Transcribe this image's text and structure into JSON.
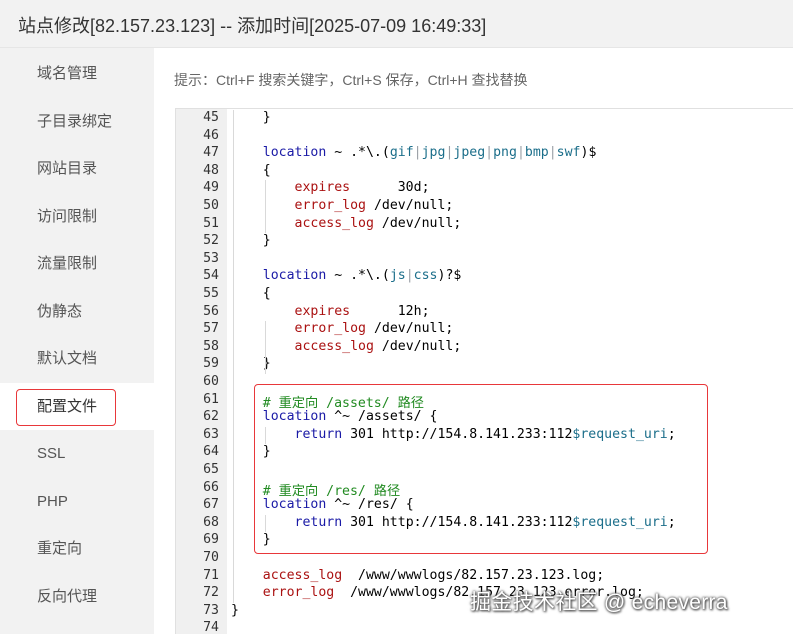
{
  "title": "站点修改[82.157.23.123] -- 添加时间[2025-07-09 16:49:33]",
  "hint": "提示：Ctrl+F 搜索关键字，Ctrl+S 保存，Ctrl+H 查找替换",
  "sidebar": {
    "items": [
      {
        "label": "域名管理",
        "active": false
      },
      {
        "label": "子目录绑定",
        "active": false
      },
      {
        "label": "网站目录",
        "active": false
      },
      {
        "label": "访问限制",
        "active": false
      },
      {
        "label": "流量限制",
        "active": false
      },
      {
        "label": "伪静态",
        "active": false
      },
      {
        "label": "默认文档",
        "active": false
      },
      {
        "label": "配置文件",
        "active": true
      },
      {
        "label": "SSL",
        "active": false
      },
      {
        "label": "PHP",
        "active": false
      },
      {
        "label": "重定向",
        "active": false
      },
      {
        "label": "反向代理",
        "active": false
      }
    ]
  },
  "editor": {
    "lines": [
      {
        "n": "45",
        "text": "    }"
      },
      {
        "n": "46",
        "text": ""
      },
      {
        "n": "47",
        "text": "    location ~ .*\\.(gif|jpg|jpeg|png|bmp|swf)$"
      },
      {
        "n": "48",
        "text": "    {"
      },
      {
        "n": "49",
        "text": "        expires      30d;"
      },
      {
        "n": "50",
        "text": "        error_log /dev/null;"
      },
      {
        "n": "51",
        "text": "        access_log /dev/null;"
      },
      {
        "n": "52",
        "text": "    }"
      },
      {
        "n": "53",
        "text": ""
      },
      {
        "n": "54",
        "text": "    location ~ .*\\.(js|css)?$"
      },
      {
        "n": "55",
        "text": "    {"
      },
      {
        "n": "56",
        "text": "        expires      12h;"
      },
      {
        "n": "57",
        "text": "        error_log /dev/null;"
      },
      {
        "n": "58",
        "text": "        access_log /dev/null;"
      },
      {
        "n": "59",
        "text": "    }"
      },
      {
        "n": "60",
        "text": ""
      },
      {
        "n": "61",
        "text": "    # 重定向 /assets/ 路径"
      },
      {
        "n": "62",
        "text": "    location ^~ /assets/ {"
      },
      {
        "n": "63",
        "text": "        return 301 http://154.8.141.233:112$request_uri;"
      },
      {
        "n": "64",
        "text": "    }"
      },
      {
        "n": "65",
        "text": ""
      },
      {
        "n": "66",
        "text": "    # 重定向 /res/ 路径"
      },
      {
        "n": "67",
        "text": "    location ^~ /res/ {"
      },
      {
        "n": "68",
        "text": "        return 301 http://154.8.141.233:112$request_uri;"
      },
      {
        "n": "69",
        "text": "    }"
      },
      {
        "n": "70",
        "text": ""
      },
      {
        "n": "71",
        "text": "    access_log  /www/wwwlogs/82.157.23.123.log;"
      },
      {
        "n": "72",
        "text": "    error_log  /www/wwwlogs/82.157.23.123.error.log;"
      },
      {
        "n": "73",
        "text": "}"
      },
      {
        "n": "74",
        "text": ""
      }
    ]
  },
  "watermark": "掘金技术社区 @ echeverra"
}
